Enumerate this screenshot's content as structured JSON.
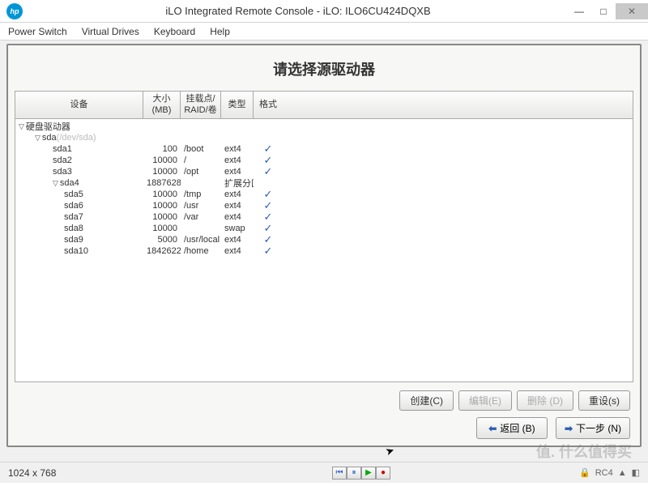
{
  "window": {
    "title": "iLO Integrated Remote Console - iLO: ILO6CU424DQXB",
    "logo_text": "hp"
  },
  "menu": {
    "power": "Power Switch",
    "vd": "Virtual Drives",
    "kb": "Keyboard",
    "help": "Help"
  },
  "dialog": {
    "title": "请选择源驱动器",
    "headers": {
      "device": "设备",
      "size": "大小\n(MB)",
      "mount": "挂载点/\nRAID/卷",
      "type": "类型",
      "format": "格式"
    },
    "root_label": "硬盘驱动器",
    "sda_label": "sda",
    "sda_hint": "(/dev/sda)",
    "rows": [
      {
        "dev": "sda1",
        "size": "100",
        "mount": "/boot",
        "type": "ext4",
        "fmt": true,
        "indent": 46
      },
      {
        "dev": "sda2",
        "size": "10000",
        "mount": "/",
        "type": "ext4",
        "fmt": true,
        "indent": 46
      },
      {
        "dev": "sda3",
        "size": "10000",
        "mount": "/opt",
        "type": "ext4",
        "fmt": true,
        "indent": 46
      },
      {
        "dev": "sda4",
        "size": "1887628",
        "mount": "",
        "type": "扩展分区",
        "fmt": false,
        "indent": 46,
        "tri": true
      },
      {
        "dev": "sda5",
        "size": "10000",
        "mount": "/tmp",
        "type": "ext4",
        "fmt": true,
        "indent": 60
      },
      {
        "dev": "sda6",
        "size": "10000",
        "mount": "/usr",
        "type": "ext4",
        "fmt": true,
        "indent": 60
      },
      {
        "dev": "sda7",
        "size": "10000",
        "mount": "/var",
        "type": "ext4",
        "fmt": true,
        "indent": 60
      },
      {
        "dev": "sda8",
        "size": "10000",
        "mount": "",
        "type": "swap",
        "fmt": true,
        "indent": 60
      },
      {
        "dev": "sda9",
        "size": "5000",
        "mount": "/usr/local",
        "type": "ext4",
        "fmt": true,
        "indent": 60
      },
      {
        "dev": "sda10",
        "size": "1842622",
        "mount": "/home",
        "type": "ext4",
        "fmt": true,
        "indent": 60
      }
    ],
    "buttons": {
      "create": "创建(C)",
      "edit": "编辑(E)",
      "delete": "删除 (D)",
      "reset": "重设(s)",
      "back": "返回 (B)",
      "next": "下一步 (N)"
    }
  },
  "status": {
    "resolution": "1024 x 768",
    "enc": "RC4",
    "watermark": "值. 什么值得买"
  }
}
